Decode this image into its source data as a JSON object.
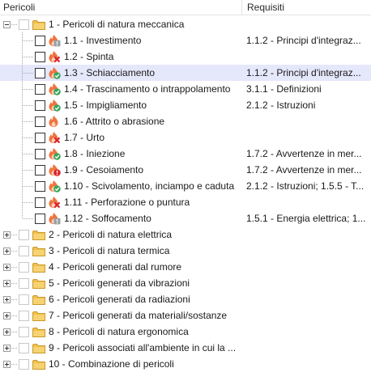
{
  "columns": {
    "pericoli": "Pericoli",
    "requisiti": "Requisiti"
  },
  "root": {
    "label": "1 - Pericoli di natura meccanica",
    "expanded": true
  },
  "children": [
    {
      "label": "1.1 - Investimento",
      "icon": "hazard-grey-warning-icon",
      "req": "1.1.2 - Principi d'integraz..."
    },
    {
      "label": "1.2 - Spinta",
      "icon": "hazard-red-x-icon",
      "req": ""
    },
    {
      "label": "1.3 - Schiacciamento",
      "icon": "hazard-green-check-icon",
      "req": "1.1.2 - Principi d'integraz...",
      "selected": true
    },
    {
      "label": "1.4 - Trascinamento o intrappolamento",
      "icon": "hazard-green-check-icon",
      "req": "3.1.1 - Definizioni"
    },
    {
      "label": "1.5 - Impigliamento",
      "icon": "hazard-green-check-icon",
      "req": "2.1.2 - Istruzioni"
    },
    {
      "label": "1.6 - Attrito o abrasione",
      "icon": "hazard-flame-icon",
      "req": ""
    },
    {
      "label": "1.7 - Urto",
      "icon": "hazard-red-x-icon",
      "req": ""
    },
    {
      "label": "1.8 - Iniezione",
      "icon": "hazard-green-check-icon",
      "req": "1.7.2 - Avvertenze in mer..."
    },
    {
      "label": "1.9 - Cesoiamento",
      "icon": "hazard-red-alert-icon",
      "req": "1.7.2 - Avvertenze in mer..."
    },
    {
      "label": "1.10 - Scivolamento, inciampo e caduta",
      "icon": "hazard-green-check-icon",
      "req": "2.1.2 - Istruzioni; 1.5.5 - T..."
    },
    {
      "label": "1.11 - Perforazione o puntura",
      "icon": "hazard-red-x-icon",
      "req": ""
    },
    {
      "label": "1.12 - Soffocamento",
      "icon": "hazard-grey-warning-icon",
      "req": "1.5.1 - Energia elettrica; 1..."
    }
  ],
  "categories": [
    {
      "label": "2 - Pericoli di natura elettrica"
    },
    {
      "label": "3 - Pericoli di natura termica"
    },
    {
      "label": "4 - Pericoli generati dal rumore"
    },
    {
      "label": "5 - Pericoli generati da vibrazioni"
    },
    {
      "label": "6 - Pericoli generati da radiazioni"
    },
    {
      "label": "7 - Pericoli generati da materiali/sostanze"
    },
    {
      "label": "8 - Pericoli di natura ergonomica"
    },
    {
      "label": "9 - Pericoli associati all'ambiente in cui la ..."
    },
    {
      "label": "10 - Combinazione di pericoli"
    }
  ],
  "colors": {
    "selection": "#e5e7fb",
    "flame": "#f0743e",
    "flame_inner": "#fbd2b8",
    "check": "#3ba55c",
    "cross": "#d9262c",
    "warning_grey": "#9aa0a6",
    "folder": "#f2c04c"
  }
}
